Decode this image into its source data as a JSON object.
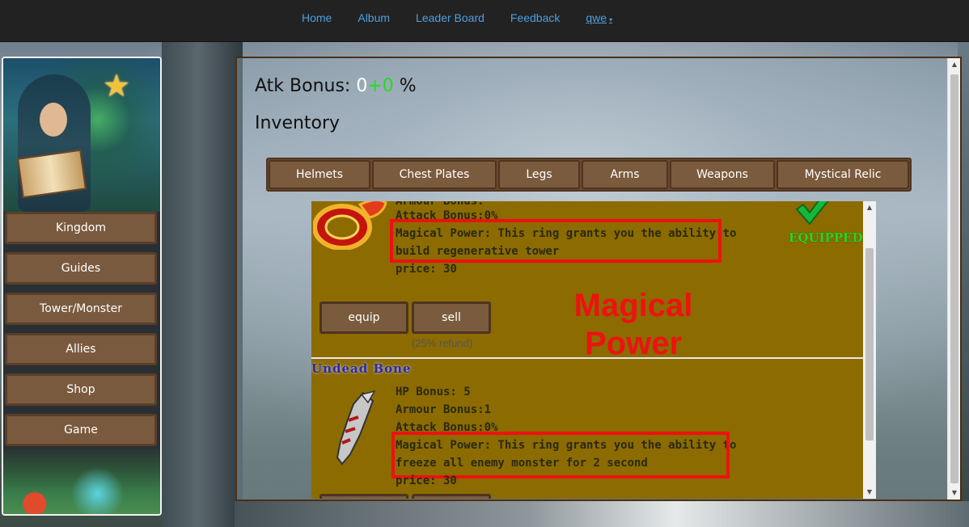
{
  "nav": {
    "items": [
      "Home",
      "Album",
      "Leader Board",
      "Feedback"
    ],
    "user": "qwe",
    "user_caret": "▾"
  },
  "sidebar": {
    "star_icon": "★",
    "items": [
      "Kingdom",
      "Guides",
      "Tower/Monster",
      "Allies",
      "Shop",
      "Game"
    ]
  },
  "main": {
    "atk_label": "Atk Bonus:",
    "atk_base": "0",
    "atk_plus": "+0",
    "atk_unit": "%",
    "inventory_title": "Inventory",
    "tabs": [
      "Helmets",
      "Chest Plates",
      "Legs",
      "Arms",
      "Weapons",
      "Mystical Relic"
    ]
  },
  "items": [
    {
      "armour_partial": "Armour Bonus:",
      "attack": "Attack Bonus:0%",
      "magical_line1": "Magical Power: This ring grants you the ability to",
      "magical_line2": "build regenerative tower",
      "price": "price: 30",
      "equipped": "EQUIPPED",
      "equip_label": "equip",
      "sell_label": "sell",
      "refund": "(25% refund)"
    },
    {
      "name": "Undead Bone",
      "hp": "HP Bonus: 5",
      "armour": "Armour Bonus:1",
      "attack": "Attack Bonus:0%",
      "magical_line1": "Magical Power: This ring grants you the ability to",
      "magical_line2": "freeze all enemy monster for 2 second",
      "price": "price: 30"
    }
  ],
  "annotation": {
    "line1": "Magical",
    "line2": "Power"
  },
  "colors": {
    "nav_bg": "#222222",
    "nav_link": "#4d9fe0",
    "button_brown": "#7b5b3d",
    "item_bg": "#8c6b00",
    "highlight_red": "#ee1111",
    "equipped_green": "#2bd12b",
    "item_name_blue": "#2a2aa8"
  }
}
